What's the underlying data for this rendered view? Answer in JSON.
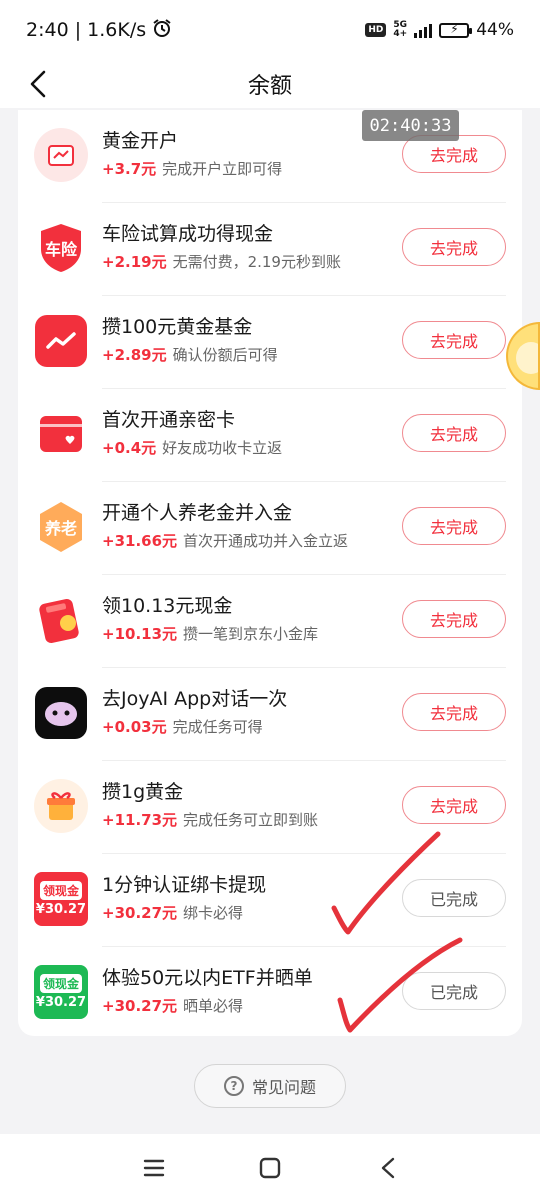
{
  "status_bar": {
    "time_speed": "2:40 | 1.6K/s",
    "network_top": "5G",
    "network_bottom": "4+",
    "hd_label": "HD",
    "battery_percent": "44%",
    "battery_level": 0.44,
    "alarm_icon": "alarm-icon"
  },
  "nav": {
    "title": "余额",
    "back_icon": "chevron-left-icon"
  },
  "timer": "02:40:33",
  "tasks": [
    {
      "title": "黄金开户",
      "amount": "+3.7元",
      "desc": "完成开户立即可得",
      "button": "去完成",
      "done": false,
      "icon": "gold-account-icon"
    },
    {
      "title": "车险试算成功得现金",
      "amount": "+2.19元",
      "desc": "无需付费，2.19元秒到账",
      "button": "去完成",
      "done": false,
      "icon": "car-insurance-icon",
      "icon_text": "车险"
    },
    {
      "title": "攒100元黄金基金",
      "amount": "+2.89元",
      "desc": "确认份额后可得",
      "button": "去完成",
      "done": false,
      "icon": "fund-chart-icon"
    },
    {
      "title": "首次开通亲密卡",
      "amount": "+0.4元",
      "desc": "好友成功收卡立返",
      "button": "去完成",
      "done": false,
      "icon": "intimate-card-icon"
    },
    {
      "title": "开通个人养老金并入金",
      "amount": "+31.66元",
      "desc": "首次开通成功并入金立返",
      "button": "去完成",
      "done": false,
      "icon": "pension-icon",
      "icon_text": "养老"
    },
    {
      "title": "领10.13元现金",
      "amount": "+10.13元",
      "desc": "攒一笔到京东小金库",
      "button": "去完成",
      "done": false,
      "icon": "red-envelope-icon"
    },
    {
      "title": "去JoyAI App对话一次",
      "amount": "+0.03元",
      "desc": "完成任务可得",
      "button": "去完成",
      "done": false,
      "icon": "joyai-app-icon"
    },
    {
      "title": "攒1g黄金",
      "amount": "+11.73元",
      "desc": "完成任务可立即到账",
      "button": "去完成",
      "done": false,
      "icon": "gold-gift-icon"
    },
    {
      "title": "1分钟认证绑卡提现",
      "amount": "+30.27元",
      "desc": "绑卡必得",
      "button": "已完成",
      "done": true,
      "icon": "cash-coupon-red-icon",
      "icon_top": "领现金",
      "icon_bottom": "¥30.27"
    },
    {
      "title": "体验50元以内ETF并晒单",
      "amount": "+30.27元",
      "desc": "晒单必得",
      "button": "已完成",
      "done": true,
      "icon": "cash-coupon-green-icon",
      "icon_top": "领现金",
      "icon_bottom": "¥30.27"
    }
  ],
  "faq": {
    "label": "常见问题",
    "icon": "question-circle-icon"
  },
  "system_nav": {
    "menu_icon": "menu-icon",
    "home_icon": "home-square-icon",
    "back_icon": "back-triangle-icon"
  },
  "colors": {
    "accent_red": "#f2303d",
    "green": "#1db954",
    "background": "#f3f3f5"
  }
}
